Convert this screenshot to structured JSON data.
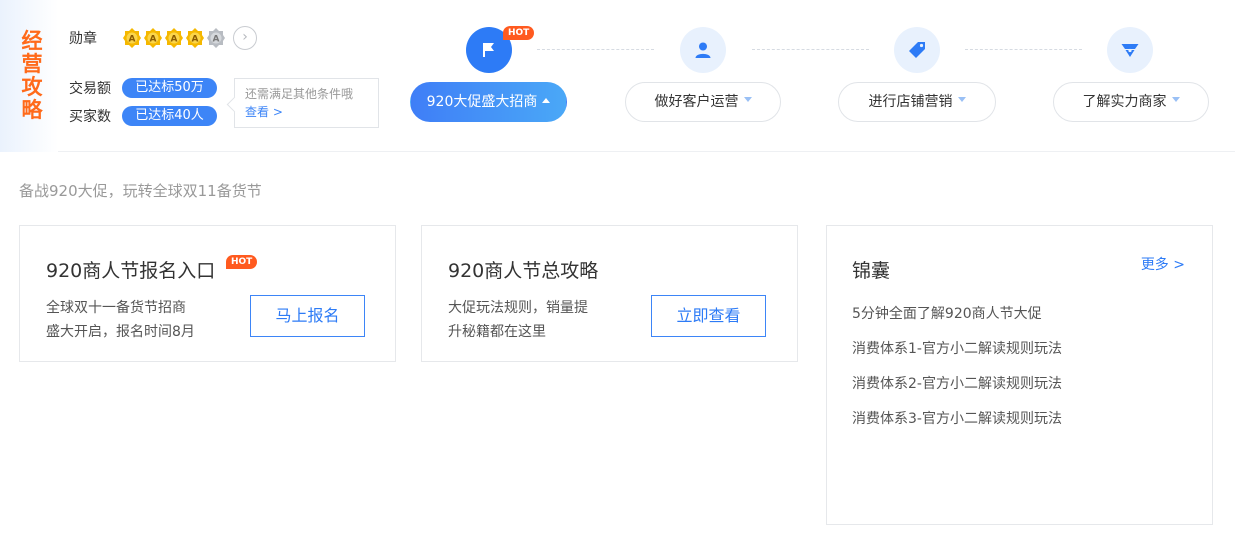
{
  "side_title": "经营攻略",
  "medal": {
    "label": "勋章",
    "badges": [
      {
        "letter": "A",
        "earned": true
      },
      {
        "letter": "A",
        "earned": true
      },
      {
        "letter": "A",
        "earned": true
      },
      {
        "letter": "A",
        "earned": true
      },
      {
        "letter": "A",
        "earned": false
      }
    ],
    "next_icon": "chevron-right-icon"
  },
  "metrics": [
    {
      "label": "交易额",
      "badge": "已达标50万"
    },
    {
      "label": "买家数",
      "badge": "已达标40人"
    }
  ],
  "tip": {
    "text": "还需满足其他条件哦",
    "link": "查看 >"
  },
  "steps": [
    {
      "label": "920大促盛大招商",
      "icon": "flag-icon",
      "active": true,
      "hot": "HOT"
    },
    {
      "label": "做好客户运营",
      "icon": "user-icon",
      "active": false
    },
    {
      "label": "进行店铺营销",
      "icon": "tag-icon",
      "active": false
    },
    {
      "label": "了解实力商家",
      "icon": "crown-icon",
      "active": false
    }
  ],
  "section_title": "备战920大促，玩转全球双11备货节",
  "cards": [
    {
      "title": "920商人节报名入口",
      "hot": "HOT",
      "desc1": "全球双十一备货节招商",
      "desc2": "盛大开启，报名时间8月",
      "button": "马上报名"
    },
    {
      "title": "920商人节总攻略",
      "desc1": "大促玩法规则，销量提",
      "desc2": "升秘籍都在这里",
      "button": "立即查看"
    }
  ],
  "tips_panel": {
    "title": "锦囊",
    "more": "更多 >",
    "items": [
      "5分钟全面了解920商人节大促",
      "消费体系1-官方小二解读规则玩法",
      "消费体系2-官方小二解读规则玩法",
      "消费体系3-官方小二解读规则玩法"
    ]
  },
  "colors": {
    "accent": "#2d7bf6",
    "hot": "#ff5a1f",
    "side_title": "#ff6a1a",
    "badge_gold": "#f5b800"
  }
}
